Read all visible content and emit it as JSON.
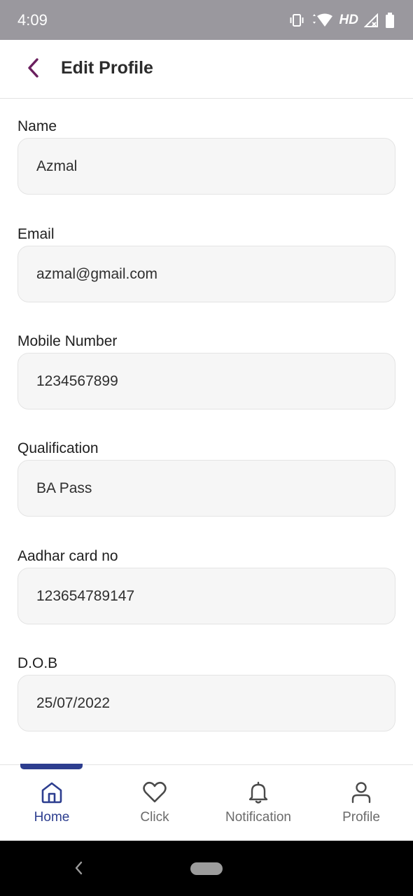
{
  "status_bar": {
    "time": "4:09",
    "network_label": "HD",
    "icons": [
      "vibrate-icon",
      "wifi-icon",
      "signal-icon",
      "battery-icon"
    ]
  },
  "header": {
    "title": "Edit Profile",
    "back_icon": "chevron-left-icon",
    "accent_color": "#6a1f5e"
  },
  "form": {
    "fields": [
      {
        "label": "Name",
        "value": "Azmal"
      },
      {
        "label": "Email",
        "value": "azmal@gmail.com"
      },
      {
        "label": "Mobile Number",
        "value": "1234567899"
      },
      {
        "label": "Qualification",
        "value": "BA Pass"
      },
      {
        "label": "Aadhar card no",
        "value": "123654789147"
      },
      {
        "label": "D.O.B",
        "value": "25/07/2022"
      }
    ]
  },
  "bottom_nav": {
    "active_color": "#2d3e8f",
    "items": [
      {
        "label": "Home",
        "icon": "home-icon",
        "active": true
      },
      {
        "label": "Click",
        "icon": "heart-icon",
        "active": false
      },
      {
        "label": "Notification",
        "icon": "bell-icon",
        "active": false
      },
      {
        "label": "Profile",
        "icon": "user-icon",
        "active": false
      }
    ]
  }
}
